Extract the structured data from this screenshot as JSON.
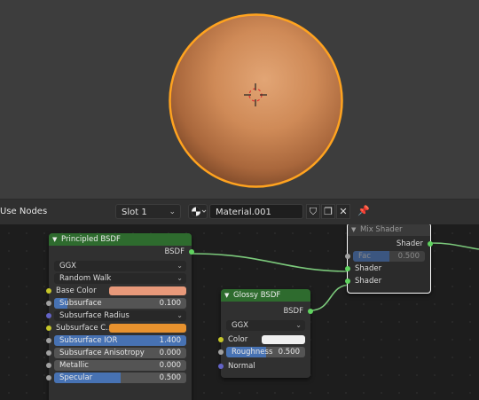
{
  "header": {
    "use_nodes": "Use Nodes",
    "slot": "Slot 1",
    "material_name": "Material.001"
  },
  "principled": {
    "title": "Principled BSDF",
    "output": "BSDF",
    "distribution": "GGX",
    "subsurface_method": "Random Walk",
    "base_color_label": "Base Color",
    "base_color": "#e8997a",
    "subsurface_label": "Subsurface",
    "subsurface_value": "0.100",
    "subsurface_fraction": 0.1,
    "subsurface_radius_label": "Subsurface Radius",
    "subsurface_color_label": "Subsurface C...",
    "subsurface_color": "#e8922e",
    "subsurface_ior_label": "Subsurface IOR",
    "subsurface_ior_value": "1.400",
    "subsurface_aniso_label": "Subsurface Anisotropy",
    "subsurface_aniso_value": "0.000",
    "metallic_label": "Metallic",
    "metallic_value": "0.000",
    "specular_label": "Specular",
    "specular_value": "0.500",
    "specular_fraction": 0.5
  },
  "glossy": {
    "title": "Glossy BSDF",
    "output": "BSDF",
    "distribution": "GGX",
    "color_label": "Color",
    "color": "#f0f0f0",
    "roughness_label": "Roughness",
    "roughness_value": "0.500",
    "roughness_fraction": 0.5,
    "normal_label": "Normal"
  },
  "mix": {
    "title": "Mix Shader",
    "output": "Shader",
    "fac_label": "Fac",
    "fac_value": "0.500",
    "fac_fraction": 0.5,
    "shader1_label": "Shader",
    "shader2_label": "Shader"
  },
  "colors": {
    "shader_header": "#2e6b2e",
    "shader_socket": "#5fd35f",
    "color_socket": "#c7c729",
    "vector_socket": "#6363c7",
    "float_socket": "#a1a1a1",
    "selection": "#ffffff",
    "sphere_outline": "#ffa31f"
  }
}
